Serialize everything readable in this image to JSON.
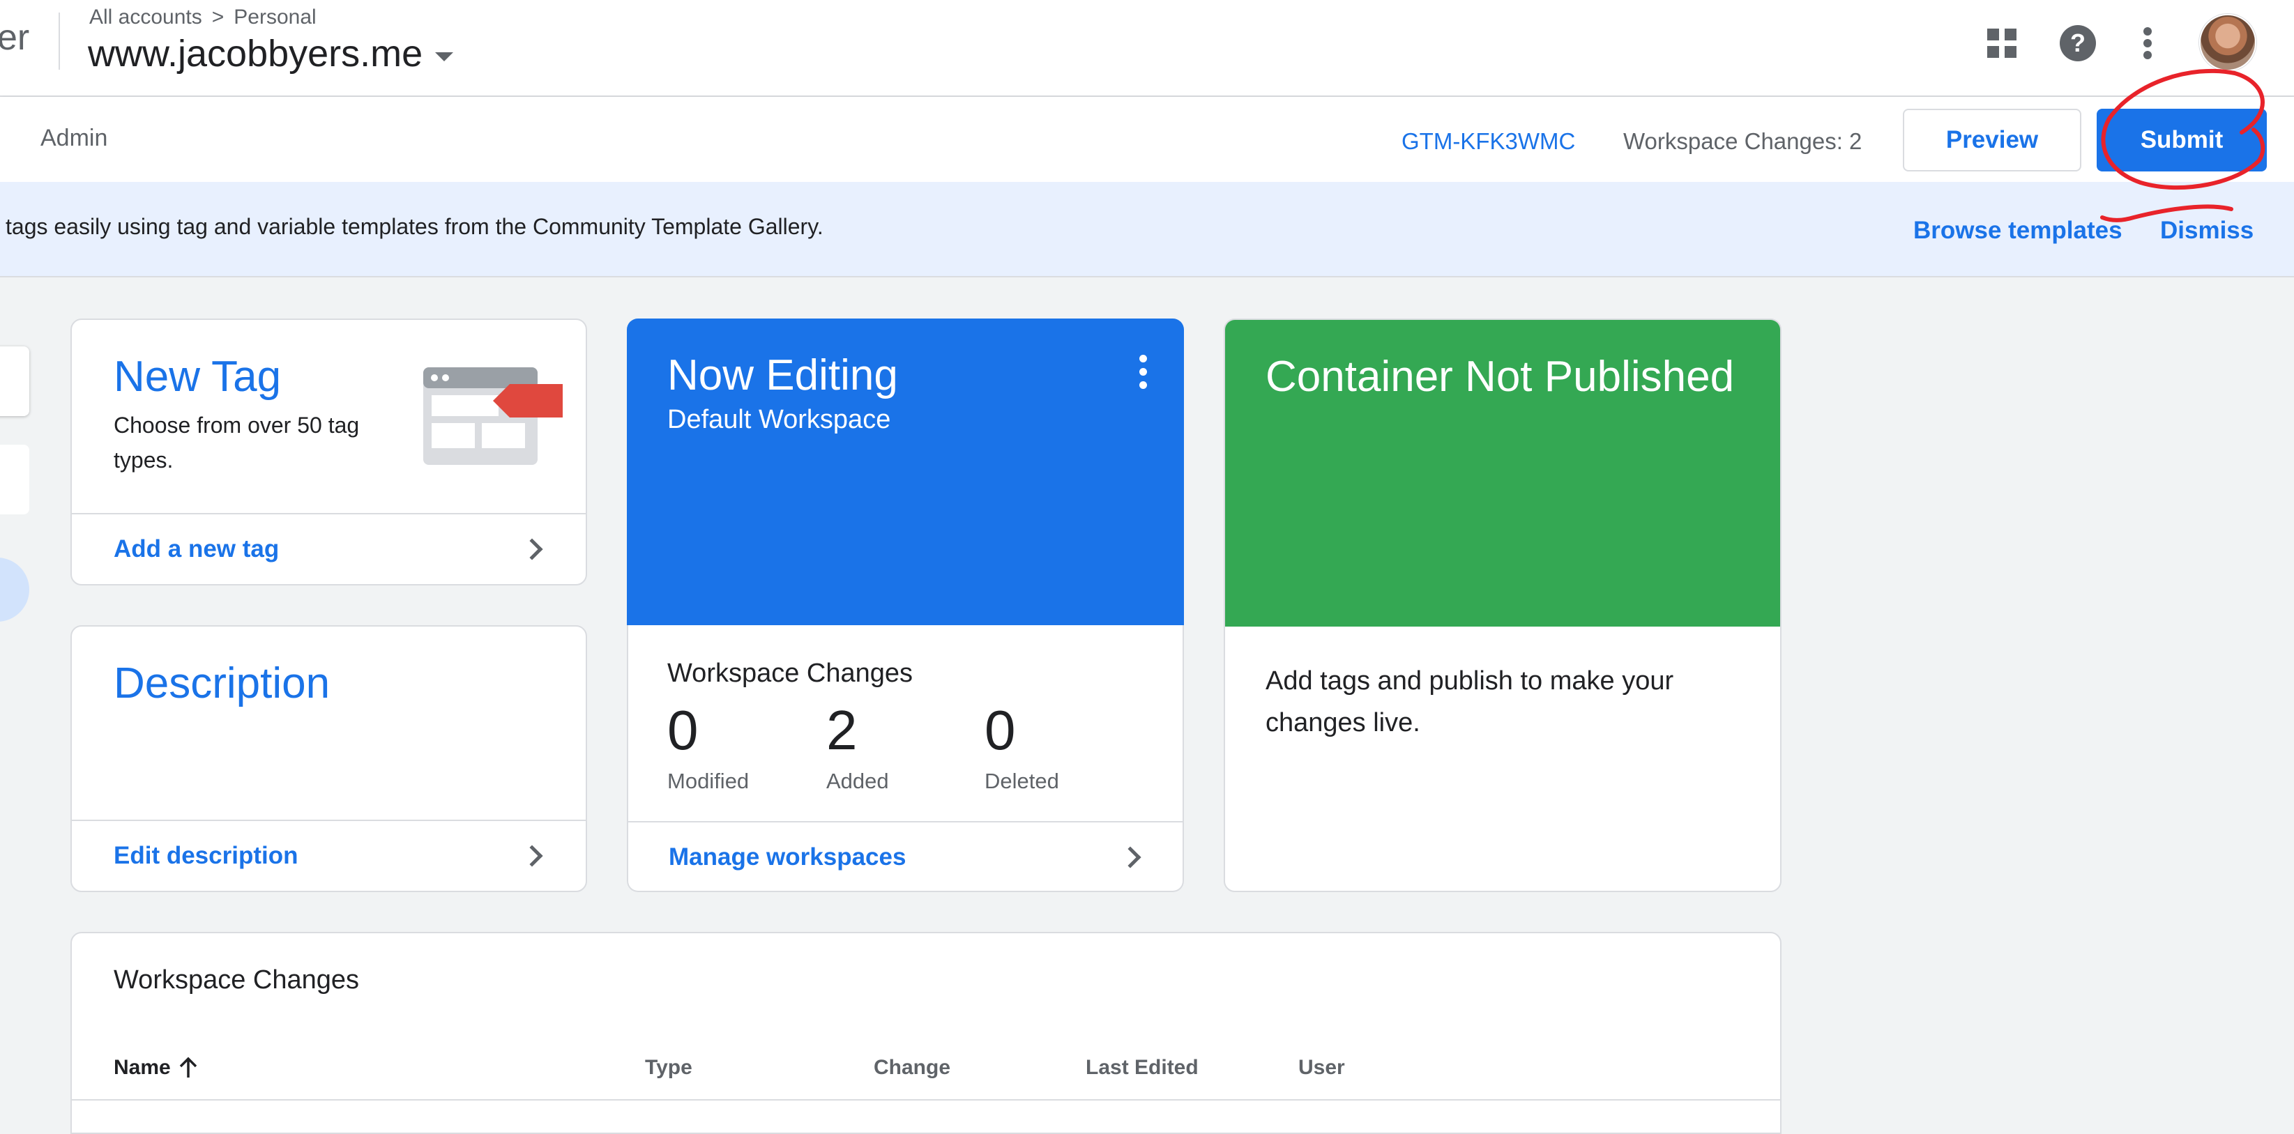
{
  "header": {
    "app_name_fragment": "er",
    "breadcrumb": [
      "All accounts",
      "Personal"
    ],
    "breadcrumb_separator": ">",
    "container_name": "www.jacobbyers.me",
    "icons": [
      "apps-grid-icon",
      "help-icon",
      "more-vert-icon",
      "avatar"
    ]
  },
  "subbar": {
    "admin_tab": "Admin",
    "container_id": "GTM-KFK3WMC",
    "workspace_changes": "Workspace Changes: 2",
    "preview_label": "Preview",
    "submit_label": "Submit"
  },
  "banner": {
    "text": "tags easily using tag and variable templates from the Community Template Gallery.",
    "browse_label": "Browse templates",
    "dismiss_label": "Dismiss"
  },
  "new_tag_card": {
    "title": "New Tag",
    "subtitle": "Choose from over 50 tag types.",
    "link": "Add a new tag"
  },
  "description_card": {
    "title": "Description",
    "link": "Edit description"
  },
  "now_editing_card": {
    "title": "Now Editing",
    "subtitle": "Default Workspace",
    "changes_label": "Workspace Changes",
    "stats": [
      {
        "value": "0",
        "label": "Modified"
      },
      {
        "value": "2",
        "label": "Added"
      },
      {
        "value": "0",
        "label": "Deleted"
      }
    ],
    "link": "Manage workspaces"
  },
  "container_card": {
    "title": "Container Not Published",
    "body": "Add tags and publish to make your changes live."
  },
  "changes_table": {
    "title": "Workspace Changes",
    "columns": [
      "Name",
      "Type",
      "Change",
      "Last Edited",
      "User"
    ],
    "sort_column": "Name",
    "sort_direction": "ascending"
  },
  "colors": {
    "accent_blue": "#1a73e8",
    "published_green": "#34a853",
    "banner_bg": "#e8f0fe",
    "annotation_red": "#e8232a"
  }
}
